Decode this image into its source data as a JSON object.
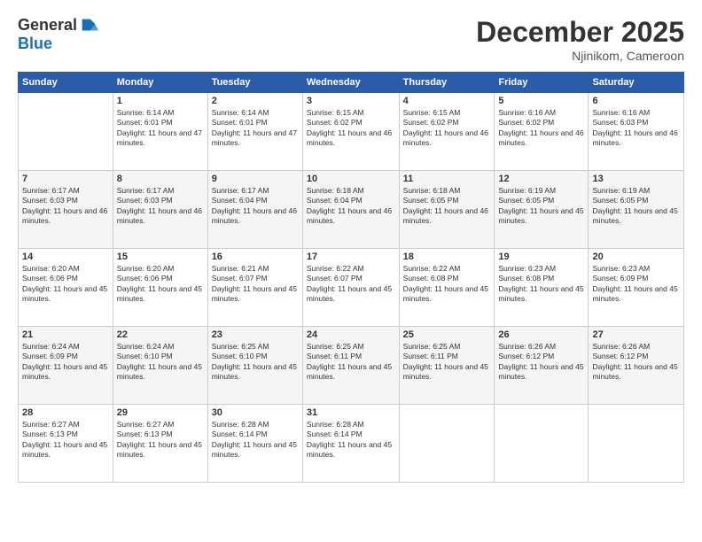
{
  "header": {
    "logo_line1": "General",
    "logo_line2": "Blue",
    "month": "December 2025",
    "location": "Njinikom, Cameroon"
  },
  "weekdays": [
    "Sunday",
    "Monday",
    "Tuesday",
    "Wednesday",
    "Thursday",
    "Friday",
    "Saturday"
  ],
  "weeks": [
    [
      {
        "day": "",
        "info": ""
      },
      {
        "day": "1",
        "info": "Sunrise: 6:14 AM\nSunset: 6:01 PM\nDaylight: 11 hours and 47 minutes."
      },
      {
        "day": "2",
        "info": "Sunrise: 6:14 AM\nSunset: 6:01 PM\nDaylight: 11 hours and 47 minutes."
      },
      {
        "day": "3",
        "info": "Sunrise: 6:15 AM\nSunset: 6:02 PM\nDaylight: 11 hours and 46 minutes."
      },
      {
        "day": "4",
        "info": "Sunrise: 6:15 AM\nSunset: 6:02 PM\nDaylight: 11 hours and 46 minutes."
      },
      {
        "day": "5",
        "info": "Sunrise: 6:16 AM\nSunset: 6:02 PM\nDaylight: 11 hours and 46 minutes."
      },
      {
        "day": "6",
        "info": "Sunrise: 6:16 AM\nSunset: 6:03 PM\nDaylight: 11 hours and 46 minutes."
      }
    ],
    [
      {
        "day": "7",
        "info": "Sunrise: 6:17 AM\nSunset: 6:03 PM\nDaylight: 11 hours and 46 minutes."
      },
      {
        "day": "8",
        "info": "Sunrise: 6:17 AM\nSunset: 6:03 PM\nDaylight: 11 hours and 46 minutes."
      },
      {
        "day": "9",
        "info": "Sunrise: 6:17 AM\nSunset: 6:04 PM\nDaylight: 11 hours and 46 minutes."
      },
      {
        "day": "10",
        "info": "Sunrise: 6:18 AM\nSunset: 6:04 PM\nDaylight: 11 hours and 46 minutes."
      },
      {
        "day": "11",
        "info": "Sunrise: 6:18 AM\nSunset: 6:05 PM\nDaylight: 11 hours and 46 minutes."
      },
      {
        "day": "12",
        "info": "Sunrise: 6:19 AM\nSunset: 6:05 PM\nDaylight: 11 hours and 45 minutes."
      },
      {
        "day": "13",
        "info": "Sunrise: 6:19 AM\nSunset: 6:05 PM\nDaylight: 11 hours and 45 minutes."
      }
    ],
    [
      {
        "day": "14",
        "info": "Sunrise: 6:20 AM\nSunset: 6:06 PM\nDaylight: 11 hours and 45 minutes."
      },
      {
        "day": "15",
        "info": "Sunrise: 6:20 AM\nSunset: 6:06 PM\nDaylight: 11 hours and 45 minutes."
      },
      {
        "day": "16",
        "info": "Sunrise: 6:21 AM\nSunset: 6:07 PM\nDaylight: 11 hours and 45 minutes."
      },
      {
        "day": "17",
        "info": "Sunrise: 6:22 AM\nSunset: 6:07 PM\nDaylight: 11 hours and 45 minutes."
      },
      {
        "day": "18",
        "info": "Sunrise: 6:22 AM\nSunset: 6:08 PM\nDaylight: 11 hours and 45 minutes."
      },
      {
        "day": "19",
        "info": "Sunrise: 6:23 AM\nSunset: 6:08 PM\nDaylight: 11 hours and 45 minutes."
      },
      {
        "day": "20",
        "info": "Sunrise: 6:23 AM\nSunset: 6:09 PM\nDaylight: 11 hours and 45 minutes."
      }
    ],
    [
      {
        "day": "21",
        "info": "Sunrise: 6:24 AM\nSunset: 6:09 PM\nDaylight: 11 hours and 45 minutes."
      },
      {
        "day": "22",
        "info": "Sunrise: 6:24 AM\nSunset: 6:10 PM\nDaylight: 11 hours and 45 minutes."
      },
      {
        "day": "23",
        "info": "Sunrise: 6:25 AM\nSunset: 6:10 PM\nDaylight: 11 hours and 45 minutes."
      },
      {
        "day": "24",
        "info": "Sunrise: 6:25 AM\nSunset: 6:11 PM\nDaylight: 11 hours and 45 minutes."
      },
      {
        "day": "25",
        "info": "Sunrise: 6:25 AM\nSunset: 6:11 PM\nDaylight: 11 hours and 45 minutes."
      },
      {
        "day": "26",
        "info": "Sunrise: 6:26 AM\nSunset: 6:12 PM\nDaylight: 11 hours and 45 minutes."
      },
      {
        "day": "27",
        "info": "Sunrise: 6:26 AM\nSunset: 6:12 PM\nDaylight: 11 hours and 45 minutes."
      }
    ],
    [
      {
        "day": "28",
        "info": "Sunrise: 6:27 AM\nSunset: 6:13 PM\nDaylight: 11 hours and 45 minutes."
      },
      {
        "day": "29",
        "info": "Sunrise: 6:27 AM\nSunset: 6:13 PM\nDaylight: 11 hours and 45 minutes."
      },
      {
        "day": "30",
        "info": "Sunrise: 6:28 AM\nSunset: 6:14 PM\nDaylight: 11 hours and 45 minutes."
      },
      {
        "day": "31",
        "info": "Sunrise: 6:28 AM\nSunset: 6:14 PM\nDaylight: 11 hours and 45 minutes."
      },
      {
        "day": "",
        "info": ""
      },
      {
        "day": "",
        "info": ""
      },
      {
        "day": "",
        "info": ""
      }
    ]
  ]
}
